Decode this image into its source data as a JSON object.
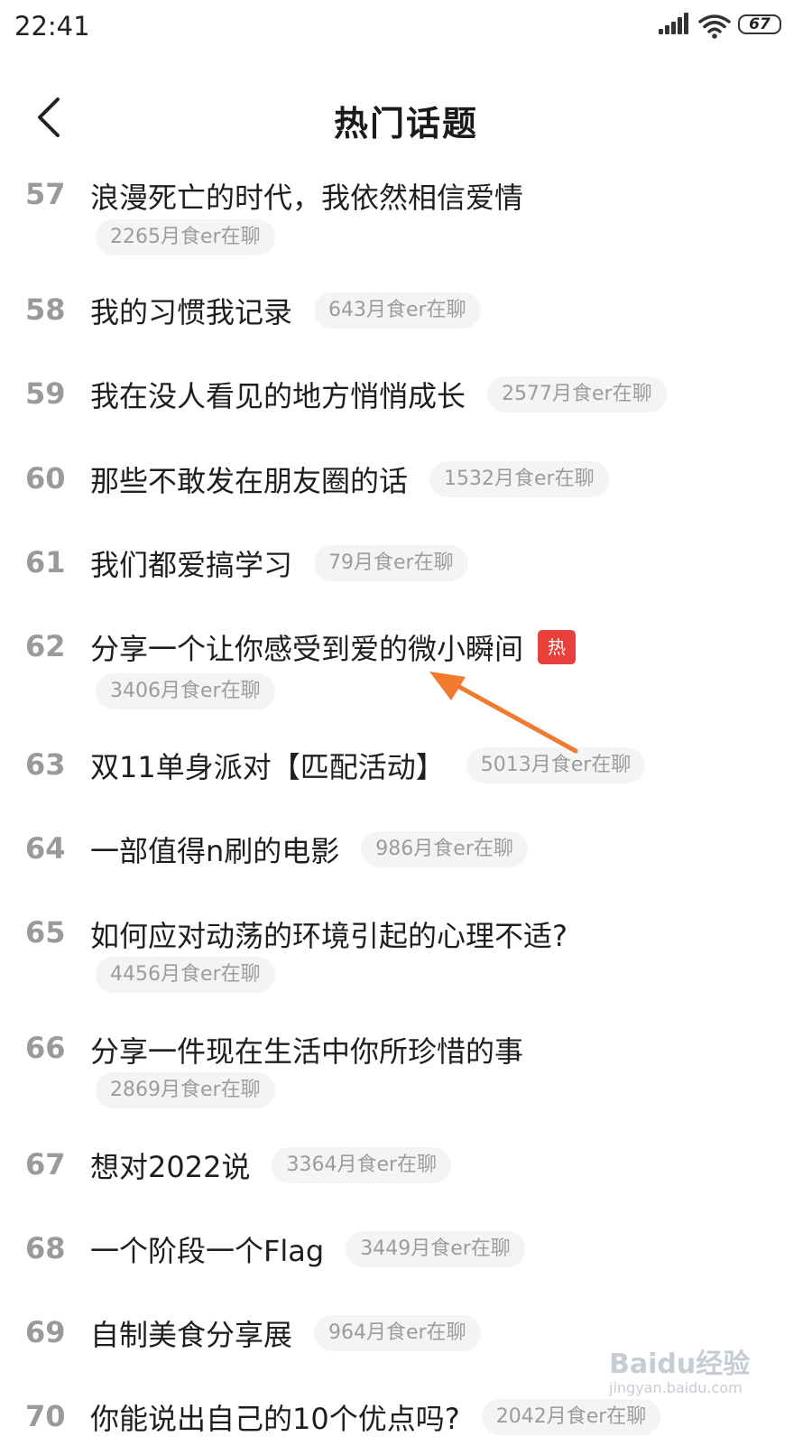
{
  "status_bar": {
    "time": "22:41",
    "battery": "67"
  },
  "header": {
    "title": "热门话题"
  },
  "topics": [
    {
      "rank": "57",
      "title": "浪漫死亡的时代，我依然相信爱情",
      "count": "2265月食er在聊"
    },
    {
      "rank": "58",
      "title": "我的习惯我记录",
      "count": "643月食er在聊"
    },
    {
      "rank": "59",
      "title": "我在没人看见的地方悄悄成长",
      "count": "2577月食er在聊"
    },
    {
      "rank": "60",
      "title": "那些不敢发在朋友圈的话",
      "count": "1532月食er在聊"
    },
    {
      "rank": "61",
      "title": "我们都爱搞学习",
      "count": "79月食er在聊"
    },
    {
      "rank": "62",
      "title": "分享一个让你感受到爱的微小瞬间",
      "count": "3406月食er在聊",
      "badge": "热"
    },
    {
      "rank": "63",
      "title": "双11单身派对【匹配活动】",
      "count": "5013月食er在聊"
    },
    {
      "rank": "64",
      "title": "一部值得n刷的电影",
      "count": "986月食er在聊"
    },
    {
      "rank": "65",
      "title": "如何应对动荡的环境引起的心理不适?",
      "count": "4456月食er在聊"
    },
    {
      "rank": "66",
      "title": "分享一件现在生活中你所珍惜的事",
      "count": "2869月食er在聊"
    },
    {
      "rank": "67",
      "title": "想对2022说",
      "count": "3364月食er在聊"
    },
    {
      "rank": "68",
      "title": "一个阶段一个Flag",
      "count": "3449月食er在聊"
    },
    {
      "rank": "69",
      "title": "自制美食分享展",
      "count": "964月食er在聊"
    },
    {
      "rank": "70",
      "title": "你能说出自己的10个优点吗?",
      "count": "2042月食er在聊"
    }
  ],
  "watermark": {
    "text": "Baidu经验",
    "sub": "jingyan.baidu.com"
  },
  "colors": {
    "hot_badge": "#e8403c",
    "annotation_arrow": "#f07a2e",
    "rank": "#9a9a9a"
  },
  "icons": {
    "back": "chevron-left-icon",
    "signal": "signal-icon",
    "wifi": "wifi-icon",
    "battery": "battery-icon"
  }
}
